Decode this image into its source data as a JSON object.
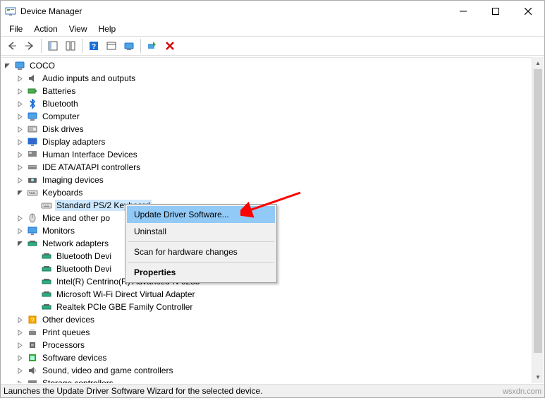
{
  "window": {
    "title": "Device Manager"
  },
  "menus": {
    "file": "File",
    "action": "Action",
    "view": "View",
    "help": "Help"
  },
  "root": {
    "label": "COCO"
  },
  "categories": [
    {
      "label": "Audio inputs and outputs",
      "exp": ">"
    },
    {
      "label": "Batteries",
      "exp": ">"
    },
    {
      "label": "Bluetooth",
      "exp": ">"
    },
    {
      "label": "Computer",
      "exp": ">"
    },
    {
      "label": "Disk drives",
      "exp": ">"
    },
    {
      "label": "Display adapters",
      "exp": ">"
    },
    {
      "label": "Human Interface Devices",
      "exp": ">"
    },
    {
      "label": "IDE ATA/ATAPI controllers",
      "exp": ">"
    },
    {
      "label": "Imaging devices",
      "exp": ">"
    },
    {
      "label": "Keyboards",
      "exp": "v",
      "children": [
        {
          "label": "Standard PS/2 Keyboard",
          "selected": true
        }
      ]
    },
    {
      "label": "Mice and other po",
      "exp": ">"
    },
    {
      "label": "Monitors",
      "exp": ">"
    },
    {
      "label": "Network adapters",
      "exp": "v",
      "children": [
        {
          "label": "Bluetooth Devi"
        },
        {
          "label": "Bluetooth Devi"
        },
        {
          "label": "Intel(R) Centrino(R) Advanced-N 6235"
        },
        {
          "label": "Microsoft Wi-Fi Direct Virtual Adapter"
        },
        {
          "label": "Realtek PCIe GBE Family Controller"
        }
      ]
    },
    {
      "label": "Other devices",
      "exp": ">"
    },
    {
      "label": "Print queues",
      "exp": ">"
    },
    {
      "label": "Processors",
      "exp": ">"
    },
    {
      "label": "Software devices",
      "exp": ">"
    },
    {
      "label": "Sound, video and game controllers",
      "exp": ">"
    },
    {
      "label": "Storage controllers",
      "exp": ">"
    }
  ],
  "context_menu": {
    "update": "Update Driver Software...",
    "uninstall": "Uninstall",
    "scan": "Scan for hardware changes",
    "properties": "Properties"
  },
  "status": "Launches the Update Driver Software Wizard for the selected device.",
  "watermark": "wsxdn.com"
}
